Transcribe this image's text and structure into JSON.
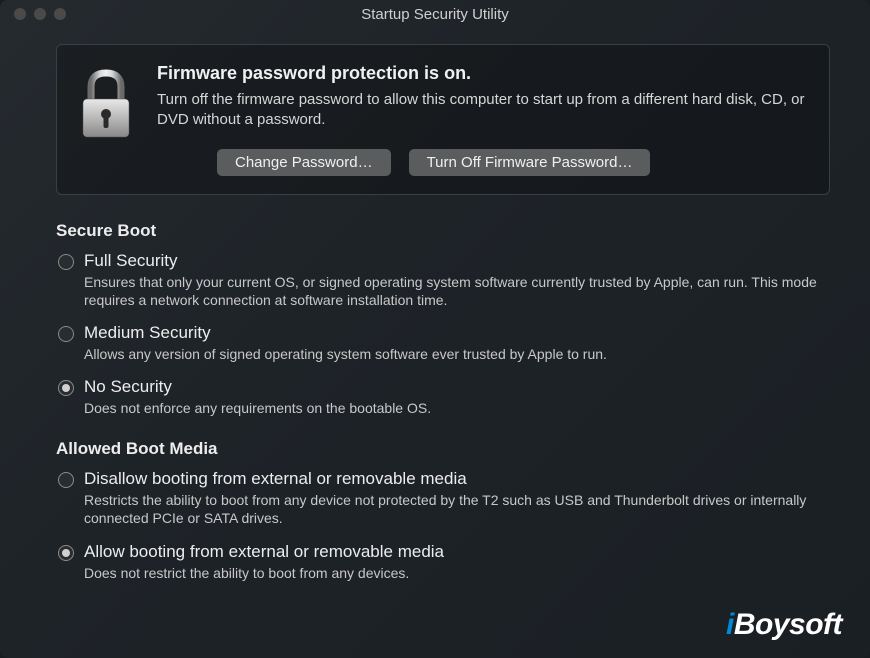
{
  "window": {
    "title": "Startup Security Utility"
  },
  "firmware": {
    "heading": "Firmware password protection is on.",
    "description": "Turn off the firmware password to allow this computer to start up from a different hard disk, CD, or DVD without a password.",
    "change_button": "Change Password…",
    "turnoff_button": "Turn Off Firmware Password…"
  },
  "secure_boot": {
    "heading": "Secure Boot",
    "options": [
      {
        "label": "Full Security",
        "description": "Ensures that only your current OS, or signed operating system software currently trusted by Apple, can run. This mode requires a network connection at software installation time.",
        "selected": false
      },
      {
        "label": "Medium Security",
        "description": "Allows any version of signed operating system software ever trusted by Apple to run.",
        "selected": false
      },
      {
        "label": "No Security",
        "description": "Does not enforce any requirements on the bootable OS.",
        "selected": true
      }
    ]
  },
  "allowed_boot": {
    "heading": "Allowed Boot Media",
    "options": [
      {
        "label": "Disallow booting from external or removable media",
        "description": "Restricts the ability to boot from any device not protected by the T2 such as USB and Thunderbolt drives or internally connected PCIe or SATA drives.",
        "selected": false
      },
      {
        "label": "Allow booting from external or removable media",
        "description": "Does not restrict the ability to boot from any devices.",
        "selected": true
      }
    ]
  },
  "watermark": {
    "prefix": "i",
    "rest": "Boysoft"
  }
}
